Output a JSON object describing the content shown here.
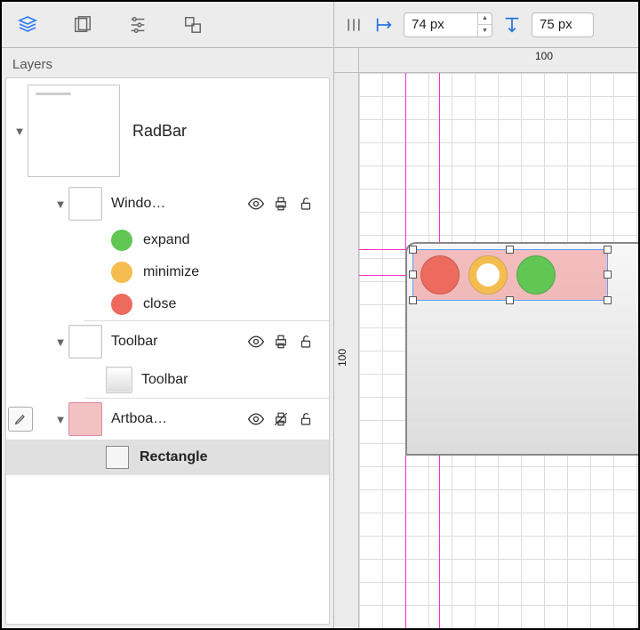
{
  "panel": {
    "title": "Layers"
  },
  "tree": {
    "root": {
      "label": "RadBar"
    },
    "window_group": {
      "label": "Windo…"
    },
    "expand": {
      "label": "expand"
    },
    "minimize": {
      "label": "minimize"
    },
    "close": {
      "label": "close"
    },
    "toolbar_group": {
      "label": "Toolbar"
    },
    "toolbar_item": {
      "label": "Toolbar"
    },
    "artboard_group": {
      "label": "Artboa…"
    },
    "rect": {
      "label": "Rectangle"
    }
  },
  "inspector": {
    "x_value": "74 px",
    "y_value": "75 px"
  },
  "ruler": {
    "h_label_100": "100",
    "v_label_100": "100"
  }
}
